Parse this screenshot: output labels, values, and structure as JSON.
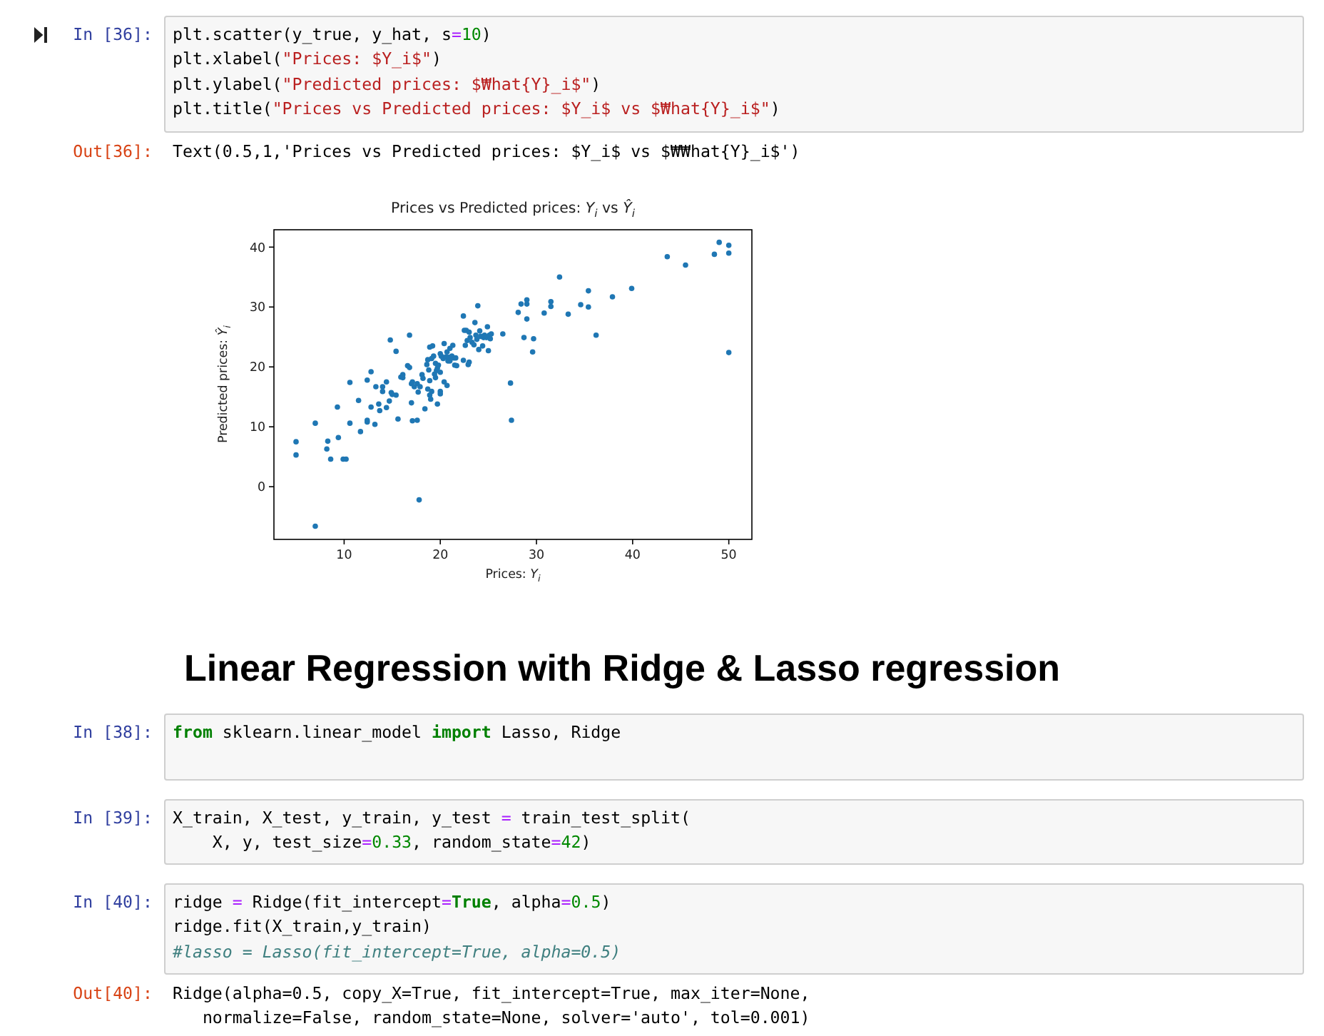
{
  "cells": [
    {
      "kind": "code",
      "prompt": "In [36]:",
      "run_button": true,
      "lines": [
        [
          {
            "kind": "plain",
            "text": "plt.scatter(y_true, y_hat, s"
          },
          {
            "kind": "operator",
            "text": "="
          },
          {
            "kind": "number",
            "text": "10"
          },
          {
            "kind": "plain",
            "text": ")"
          }
        ],
        [
          {
            "kind": "plain",
            "text": "plt.xlabel("
          },
          {
            "kind": "string",
            "text": "\"Prices: $Y_i$\""
          },
          {
            "kind": "plain",
            "text": ")"
          }
        ],
        [
          {
            "kind": "plain",
            "text": "plt.ylabel("
          },
          {
            "kind": "string",
            "text": "\"Predicted prices: $₩hat{Y}_i$\""
          },
          {
            "kind": "plain",
            "text": ")"
          }
        ],
        [
          {
            "kind": "plain",
            "text": "plt.title("
          },
          {
            "kind": "string",
            "text": "\"Prices vs Predicted prices: $Y_i$ vs $₩hat{Y}_i$\""
          },
          {
            "kind": "plain",
            "text": ")"
          }
        ]
      ],
      "outputs": [
        {
          "kind": "text",
          "prompt": "Out[36]:",
          "lines": [
            "Text(0.5,1,'Prices vs Predicted prices: $Y_i$ vs $₩₩hat{Y}_i$')"
          ]
        },
        {
          "kind": "chart",
          "chart_data": {
            "type": "scatter",
            "title": "Prices vs Predicted prices: *Y*$_{i}$ vs *Ŷ*$_{i}$",
            "xlabel": "Prices: *Y*$_{i}$",
            "ylabel": "Predicted prices: *Ŷ*$_{i}$",
            "xlim": [
              2.7,
              52.4
            ],
            "ylim": [
              -8.8,
              42.9
            ],
            "xticks": [
              10,
              20,
              30,
              40,
              50
            ],
            "yticks": [
              0,
              10,
              20,
              30,
              40
            ],
            "x": [
              5.0,
              5.0,
              7.0,
              7.0,
              8.3,
              8.2,
              8.6,
              9.3,
              9.4,
              9.9,
              10.2,
              10.6,
              10.6,
              11.7,
              11.5,
              12.4,
              12.4,
              12.4,
              12.8,
              12.8,
              13.2,
              13.3,
              13.6,
              13.7,
              14.0,
              14.0,
              14.4,
              14.4,
              14.7,
              14.8,
              14.9,
              15.0,
              15.4,
              15.4,
              15.6,
              15.9,
              16.1,
              16.1,
              16.6,
              16.8,
              16.8,
              17.0,
              17.0,
              17.1,
              17.1,
              17.3,
              17.6,
              17.6,
              17.7,
              17.8,
              17.9,
              18.1,
              18.2,
              18.4,
              18.6,
              18.7,
              18.7,
              18.8,
              18.9,
              18.9,
              18.9,
              19.0,
              19.1,
              19.1,
              19.2,
              19.3,
              19.4,
              19.5,
              19.5,
              19.6,
              19.7,
              19.7,
              19.8,
              20.0,
              20.0,
              20.0,
              20.0,
              20.1,
              20.3,
              20.4,
              20.4,
              20.7,
              20.6,
              20.7,
              20.8,
              20.9,
              21.0,
              21.0,
              21.2,
              21.3,
              21.4,
              21.5,
              21.6,
              21.7,
              22.4,
              22.4,
              22.5,
              22.6,
              22.7,
              22.8,
              22.9,
              23.0,
              23.0,
              23.1,
              23.3,
              23.5,
              23.6,
              23.7,
              23.8,
              23.9,
              24.0,
              24.1,
              24.2,
              24.4,
              24.5,
              24.6,
              24.8,
              24.9,
              25.0,
              25.1,
              25.2,
              25.3,
              26.5,
              27.3,
              27.4,
              28.1,
              28.4,
              28.7,
              29.0,
              29.0,
              29.0,
              29.6,
              29.7,
              30.8,
              31.5,
              31.5,
              32.4,
              33.3,
              34.6,
              35.4,
              35.4,
              36.2,
              37.9,
              39.9,
              43.6,
              45.5,
              48.5,
              49.0,
              50.0,
              50.0,
              50.0
            ],
            "series": [
              {
                "color": "#1f77b4",
                "values": [
                  7.5,
                  5.3,
                  10.6,
                  -6.6,
                  7.6,
                  6.3,
                  4.6,
                  13.3,
                  8.2,
                  4.6,
                  4.6,
                  17.4,
                  10.6,
                  9.2,
                  14.4,
                  17.8,
                  11.1,
                  10.8,
                  19.2,
                  13.3,
                  10.4,
                  16.7,
                  13.8,
                  12.7,
                  16.7,
                  15.9,
                  17.5,
                  13.2,
                  14.3,
                  24.5,
                  15.7,
                  15.4,
                  15.3,
                  22.6,
                  11.3,
                  18.3,
                  18.7,
                  18.2,
                  20.2,
                  25.3,
                  19.9,
                  17.2,
                  14.0,
                  11.0,
                  17.5,
                  16.7,
                  17.2,
                  11.1,
                  15.8,
                  -2.2,
                  16.7,
                  18.7,
                  18.1,
                  13.0,
                  20.4,
                  21.2,
                  16.3,
                  19.5,
                  15.3,
                  17.7,
                  23.3,
                  14.6,
                  21.4,
                  15.9,
                  23.5,
                  21.8,
                  18.8,
                  20.6,
                  18.2,
                  19.4,
                  13.8,
                  19.8,
                  20.3,
                  22.2,
                  15.9,
                  19.1,
                  15.5,
                  21.8,
                  21.4,
                  17.5,
                  23.9,
                  16.9,
                  21.7,
                  22.5,
                  21.0,
                  21.6,
                  23.1,
                  21.0,
                  21.8,
                  23.6,
                  21.5,
                  20.3,
                  21.5,
                  20.2,
                  28.5,
                  21.1,
                  26.1,
                  23.6,
                  26.1,
                  24.4,
                  20.4,
                  25.8,
                  20.8,
                  24.9,
                  24.1,
                  23.7,
                  27.4,
                  25.3,
                  24.6,
                  30.2,
                  22.9,
                  26.0,
                  25.1,
                  23.5,
                  24.9,
                  25.3,
                  24.9,
                  26.7,
                  22.7,
                  25.3,
                  24.7,
                  25.5,
                  25.5,
                  17.3,
                  11.1,
                  29.1,
                  30.5,
                  24.9,
                  30.5,
                  31.2,
                  28.0,
                  22.5,
                  24.7,
                  29.0,
                  30.9,
                  30.1,
                  35.0,
                  28.8,
                  30.4,
                  32.7,
                  30.0,
                  25.3,
                  31.7,
                  33.1,
                  38.4,
                  37.0,
                  38.8,
                  40.8,
                  40.3,
                  39.0,
                  22.4
                ]
              }
            ]
          }
        }
      ]
    },
    {
      "kind": "markdown",
      "heading": "Linear Regression with Ridge & Lasso regression"
    },
    {
      "kind": "code",
      "prompt": "In [38]:",
      "run_button": false,
      "lines": [
        [
          {
            "kind": "keyword",
            "text": "from"
          },
          {
            "kind": "plain",
            "text": " sklearn.linear_model "
          },
          {
            "kind": "keyword",
            "text": "import"
          },
          {
            "kind": "plain",
            "text": " Lasso, Ridge"
          }
        ]
      ]
    },
    {
      "kind": "code",
      "prompt": "In [39]:",
      "run_button": false,
      "lines": [
        [
          {
            "kind": "plain",
            "text": "X_train, X_test, y_train, y_test "
          },
          {
            "kind": "operator",
            "text": "="
          },
          {
            "kind": "plain",
            "text": " train_test_split("
          }
        ],
        [
          {
            "kind": "plain",
            "text": "    X, y, test_size"
          },
          {
            "kind": "operator",
            "text": "="
          },
          {
            "kind": "number",
            "text": "0.33"
          },
          {
            "kind": "plain",
            "text": ", random_state"
          },
          {
            "kind": "operator",
            "text": "="
          },
          {
            "kind": "number",
            "text": "42"
          },
          {
            "kind": "plain",
            "text": ")"
          }
        ]
      ]
    },
    {
      "kind": "code",
      "prompt": "In [40]:",
      "run_button": false,
      "lines": [
        [
          {
            "kind": "plain",
            "text": "ridge "
          },
          {
            "kind": "operator",
            "text": "="
          },
          {
            "kind": "plain",
            "text": " Ridge(fit_intercept"
          },
          {
            "kind": "operator",
            "text": "="
          },
          {
            "kind": "keyword",
            "text": "True"
          },
          {
            "kind": "plain",
            "text": ", alpha"
          },
          {
            "kind": "operator",
            "text": "="
          },
          {
            "kind": "number",
            "text": "0.5"
          },
          {
            "kind": "plain",
            "text": ")"
          }
        ],
        [
          {
            "kind": "plain",
            "text": "ridge.fit(X_train,y_train)"
          }
        ],
        [
          {
            "kind": "comment",
            "text": "#lasso = Lasso(fit_intercept=True, alpha=0.5)"
          }
        ]
      ],
      "outputs": [
        {
          "kind": "text",
          "prompt": "Out[40]:",
          "lines": [
            "Ridge(alpha=0.5, copy_X=True, fit_intercept=True, max_iter=None,",
            "   normalize=False, random_state=None, solver='auto', tol=0.001)"
          ]
        }
      ]
    }
  ]
}
